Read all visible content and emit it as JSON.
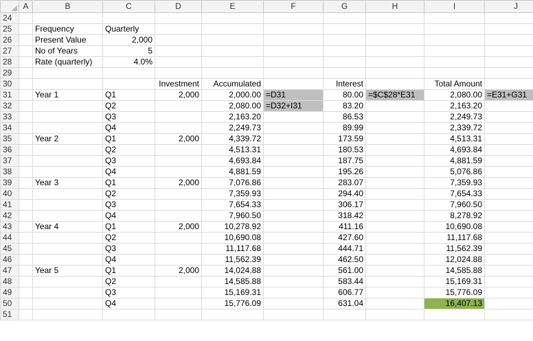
{
  "columns": [
    "A",
    "B",
    "C",
    "D",
    "E",
    "F",
    "G",
    "H",
    "I",
    "J"
  ],
  "rows": [
    {
      "num": "24",
      "cells": [
        "",
        "",
        "",
        "",
        "",
        "",
        "",
        "",
        "",
        ""
      ]
    },
    {
      "num": "25",
      "cells": [
        "",
        "Frequency",
        "Quarterly",
        "",
        "",
        "",
        "",
        "",
        "",
        ""
      ]
    },
    {
      "num": "26",
      "cells": [
        "",
        "Present Value",
        "2,000",
        "",
        "",
        "",
        "",
        "",
        "",
        ""
      ]
    },
    {
      "num": "27",
      "cells": [
        "",
        "No of Years",
        "5",
        "",
        "",
        "",
        "",
        "",
        "",
        ""
      ]
    },
    {
      "num": "28",
      "cells": [
        "",
        "Rate (quarterly)",
        "4.0%",
        "",
        "",
        "",
        "",
        "",
        "",
        ""
      ]
    },
    {
      "num": "29",
      "cells": [
        "",
        "",
        "",
        "",
        "",
        "",
        "",
        "",
        "",
        ""
      ]
    },
    {
      "num": "30",
      "cells": [
        "",
        "",
        "",
        "Investment",
        "Accumulated",
        "",
        "Interest",
        "",
        "Total Amount",
        ""
      ]
    },
    {
      "num": "31",
      "cells": [
        "",
        "Year 1",
        "Q1",
        "2,000",
        "2,000.00",
        "=D31",
        "80.00",
        "=$C$28*E31",
        "2,080.00",
        "=E31+G31"
      ]
    },
    {
      "num": "32",
      "cells": [
        "",
        "",
        "Q2",
        "",
        "2,080.00",
        "=D32+I31",
        "83.20",
        "",
        "2,163.20",
        ""
      ]
    },
    {
      "num": "33",
      "cells": [
        "",
        "",
        "Q3",
        "",
        "2,163.20",
        "",
        "86.53",
        "",
        "2,249.73",
        ""
      ]
    },
    {
      "num": "34",
      "cells": [
        "",
        "",
        "Q4",
        "",
        "2,249.73",
        "",
        "89.99",
        "",
        "2,339.72",
        ""
      ]
    },
    {
      "num": "35",
      "cells": [
        "",
        "Year 2",
        "Q1",
        "2,000",
        "4,339.72",
        "",
        "173.59",
        "",
        "4,513.31",
        ""
      ]
    },
    {
      "num": "36",
      "cells": [
        "",
        "",
        "Q2",
        "",
        "4,513.31",
        "",
        "180.53",
        "",
        "4,693.84",
        ""
      ]
    },
    {
      "num": "37",
      "cells": [
        "",
        "",
        "Q3",
        "",
        "4,693.84",
        "",
        "187.75",
        "",
        "4,881.59",
        ""
      ]
    },
    {
      "num": "38",
      "cells": [
        "",
        "",
        "Q4",
        "",
        "4,881.59",
        "",
        "195.26",
        "",
        "5,076.86",
        ""
      ]
    },
    {
      "num": "39",
      "cells": [
        "",
        "Year 3",
        "Q1",
        "2,000",
        "7,076.86",
        "",
        "283.07",
        "",
        "7,359.93",
        ""
      ]
    },
    {
      "num": "40",
      "cells": [
        "",
        "",
        "Q2",
        "",
        "7,359.93",
        "",
        "294.40",
        "",
        "7,654.33",
        ""
      ]
    },
    {
      "num": "41",
      "cells": [
        "",
        "",
        "Q3",
        "",
        "7,654.33",
        "",
        "306.17",
        "",
        "7,960.50",
        ""
      ]
    },
    {
      "num": "42",
      "cells": [
        "",
        "",
        "Q4",
        "",
        "7,960.50",
        "",
        "318.42",
        "",
        "8,278.92",
        ""
      ]
    },
    {
      "num": "43",
      "cells": [
        "",
        "Year 4",
        "Q1",
        "2,000",
        "10,278.92",
        "",
        "411.16",
        "",
        "10,690.08",
        ""
      ]
    },
    {
      "num": "44",
      "cells": [
        "",
        "",
        "Q2",
        "",
        "10,690.08",
        "",
        "427.60",
        "",
        "11,117.68",
        ""
      ]
    },
    {
      "num": "45",
      "cells": [
        "",
        "",
        "Q3",
        "",
        "11,117.68",
        "",
        "444.71",
        "",
        "11,562.39",
        ""
      ]
    },
    {
      "num": "46",
      "cells": [
        "",
        "",
        "Q4",
        "",
        "11,562.39",
        "",
        "462.50",
        "",
        "12,024.88",
        ""
      ]
    },
    {
      "num": "47",
      "cells": [
        "",
        "Year 5",
        "Q1",
        "2,000",
        "14,024.88",
        "",
        "561.00",
        "",
        "14,585.88",
        ""
      ]
    },
    {
      "num": "48",
      "cells": [
        "",
        "",
        "Q2",
        "",
        "14,585.88",
        "",
        "583.44",
        "",
        "15,169.31",
        ""
      ]
    },
    {
      "num": "49",
      "cells": [
        "",
        "",
        "Q3",
        "",
        "15,169.31",
        "",
        "606.77",
        "",
        "15,776.09",
        ""
      ]
    },
    {
      "num": "50",
      "cells": [
        "",
        "",
        "Q4",
        "",
        "15,776.09",
        "",
        "631.04",
        "",
        "16,407.13",
        ""
      ]
    },
    {
      "num": "51",
      "cells": [
        "",
        "",
        "",
        "",
        "",
        "",
        "",
        "",
        "",
        ""
      ]
    }
  ],
  "colors": {
    "formula_note_bg": "#bfbfbf",
    "result_highlight": "#8eb34f",
    "header_bg": "#f3f3f3"
  }
}
